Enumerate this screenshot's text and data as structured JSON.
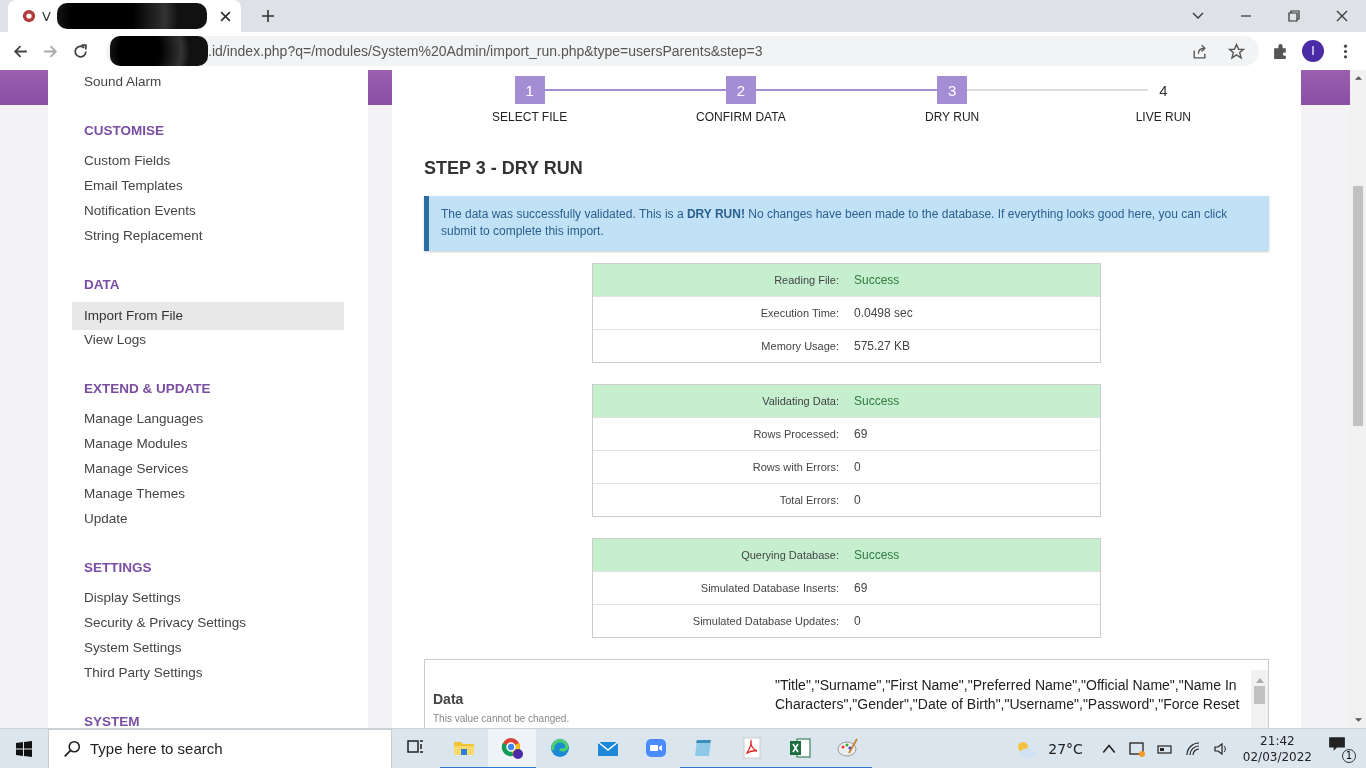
{
  "browser": {
    "tab_title": "V",
    "url": ".id/index.php?q=/modules/System%20Admin/import_run.php&type=usersParents&step=3",
    "profile_initial": "I"
  },
  "sidebar": {
    "sections": [
      {
        "items": [
          {
            "label": "Sound Alarm",
            "selected": false
          }
        ]
      },
      {
        "heading": "CUSTOMISE",
        "items": [
          {
            "label": "Custom Fields",
            "selected": false
          },
          {
            "label": "Email Templates",
            "selected": false
          },
          {
            "label": "Notification Events",
            "selected": false
          },
          {
            "label": "String Replacement",
            "selected": false
          }
        ]
      },
      {
        "heading": "DATA",
        "items": [
          {
            "label": "Import From File",
            "selected": true
          },
          {
            "label": "View Logs",
            "selected": false
          }
        ]
      },
      {
        "heading": "EXTEND & UPDATE",
        "items": [
          {
            "label": "Manage Languages",
            "selected": false
          },
          {
            "label": "Manage Modules",
            "selected": false
          },
          {
            "label": "Manage Services",
            "selected": false
          },
          {
            "label": "Manage Themes",
            "selected": false
          },
          {
            "label": "Update",
            "selected": false
          }
        ]
      },
      {
        "heading": "SETTINGS",
        "items": [
          {
            "label": "Display Settings",
            "selected": false
          },
          {
            "label": "Security & Privacy Settings",
            "selected": false
          },
          {
            "label": "System Settings",
            "selected": false
          },
          {
            "label": "Third Party Settings",
            "selected": false
          }
        ]
      },
      {
        "heading": "SYSTEM"
      }
    ]
  },
  "steps": [
    {
      "number": "1",
      "label": "SELECT FILE",
      "reached": true
    },
    {
      "number": "2",
      "label": "CONFIRM DATA",
      "reached": true
    },
    {
      "number": "3",
      "label": "DRY RUN",
      "reached": true
    },
    {
      "number": "4",
      "label": "LIVE RUN",
      "reached": false
    }
  ],
  "heading": "STEP 3 - DRY RUN",
  "alert": "The data was successfully validated. This is a **DRY RUN!** No changes have been made to the database. If everything looks good here, you can click submit to complete this import.",
  "result_tables": [
    {
      "rows": [
        {
          "label": "Reading File:",
          "value": "Success",
          "kind": "status"
        },
        {
          "label": "Execution Time:",
          "value": "0.0498 sec",
          "kind": "plain"
        },
        {
          "label": "Memory Usage:",
          "value": "575.27 KB",
          "kind": "plain"
        }
      ]
    },
    {
      "rows": [
        {
          "label": "Validating Data:",
          "value": "Success",
          "kind": "status"
        },
        {
          "label": "Rows Processed:",
          "value": "69",
          "kind": "plain"
        },
        {
          "label": "Rows with Errors:",
          "value": "0",
          "kind": "plain"
        },
        {
          "label": "Total Errors:",
          "value": "0",
          "kind": "plain"
        }
      ]
    },
    {
      "rows": [
        {
          "label": "Querying Database:",
          "value": "Success",
          "kind": "status"
        },
        {
          "label": "Simulated Database Inserts:",
          "value": "69",
          "kind": "plain"
        },
        {
          "label": "Simulated Database Updates:",
          "value": "0",
          "kind": "plain"
        }
      ]
    }
  ],
  "data_field": {
    "label": "Data",
    "note": "This value cannot be changed.",
    "value": "\"Title\",\"Surname\",\"First Name\",\"Preferred Name\",\"Official Name\",\"Name In Characters\",\"Gender\",\"Date of Birth\",\"Username\",\"Password\",\"Force Reset"
  },
  "taskbar": {
    "search_placeholder": "Type here to search",
    "apps": [
      {
        "kind": "taskview",
        "running": false,
        "selected": false
      },
      {
        "kind": "folder",
        "running": true,
        "selected": false
      },
      {
        "kind": "chrome",
        "running": true,
        "selected": true
      },
      {
        "kind": "edge",
        "running": false,
        "selected": false
      },
      {
        "kind": "mail",
        "running": false,
        "selected": false
      },
      {
        "kind": "video",
        "running": false,
        "selected": false
      },
      {
        "kind": "notepad",
        "running": true,
        "selected": false
      },
      {
        "kind": "pdf",
        "running": true,
        "selected": false
      },
      {
        "kind": "sheet",
        "running": true,
        "selected": false
      },
      {
        "kind": "paint",
        "running": true,
        "selected": false
      }
    ],
    "temperature": "27°C",
    "time": "21:42",
    "date": "02/03/2022",
    "notifications": "1"
  }
}
